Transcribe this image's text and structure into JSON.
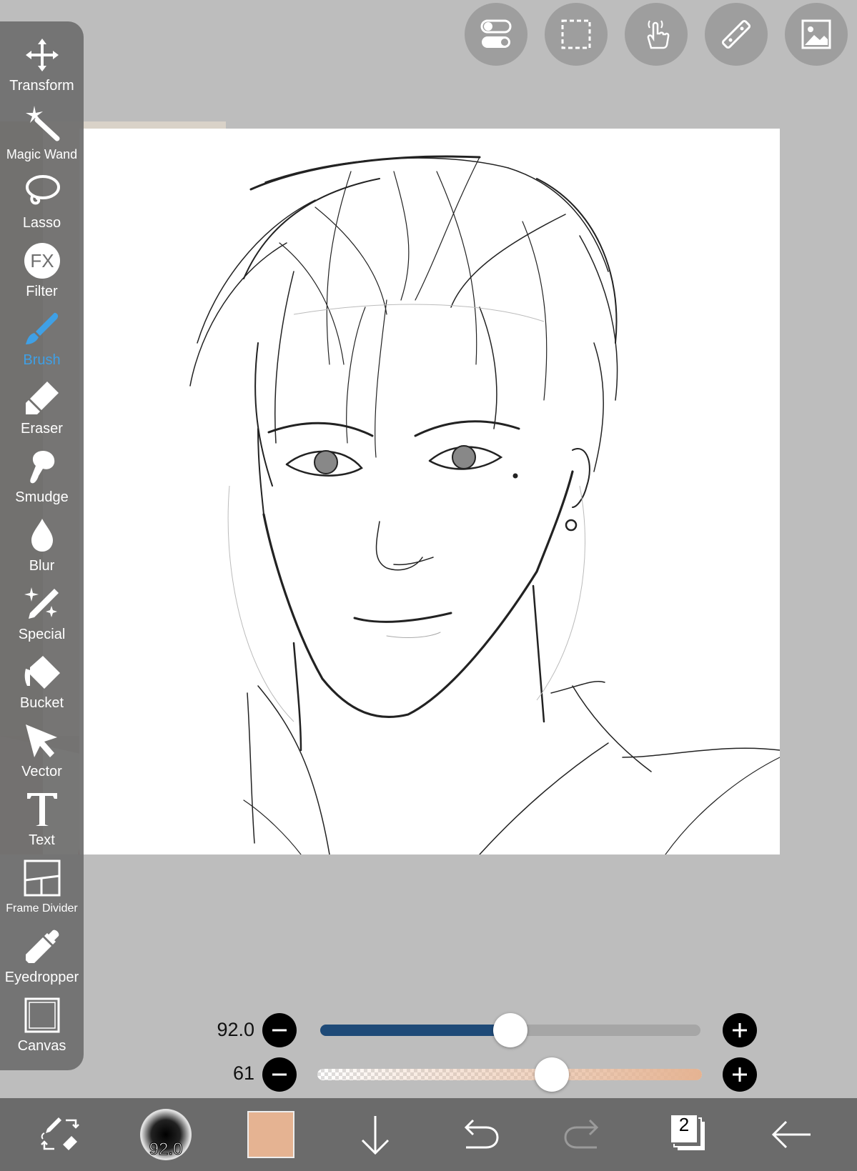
{
  "top_toolbar": {
    "buttons": [
      {
        "icon": "toggle-icon"
      },
      {
        "icon": "selection-icon"
      },
      {
        "icon": "touch-icon"
      },
      {
        "icon": "ruler-icon"
      },
      {
        "icon": "reference-image-icon"
      }
    ]
  },
  "sidebar": {
    "tools": [
      {
        "label": "Transform",
        "icon": "transform-icon"
      },
      {
        "label": "Magic Wand",
        "icon": "magic-wand-icon"
      },
      {
        "label": "Lasso",
        "icon": "lasso-icon"
      },
      {
        "label": "Filter",
        "icon": "fx-icon"
      },
      {
        "label": "Brush",
        "icon": "brush-icon",
        "active": true
      },
      {
        "label": "Eraser",
        "icon": "eraser-icon"
      },
      {
        "label": "Smudge",
        "icon": "smudge-icon"
      },
      {
        "label": "Blur",
        "icon": "blur-icon"
      },
      {
        "label": "Special",
        "icon": "special-icon"
      },
      {
        "label": "Bucket",
        "icon": "bucket-icon"
      },
      {
        "label": "Vector",
        "icon": "vector-icon"
      },
      {
        "label": "Text",
        "icon": "text-icon"
      },
      {
        "label": "Frame Divider",
        "icon": "frame-divider-icon"
      },
      {
        "label": "Eyedropper",
        "icon": "eyedropper-icon"
      },
      {
        "label": "Canvas",
        "icon": "canvas-icon"
      }
    ]
  },
  "sliders": {
    "size": {
      "value": "92.0",
      "fill": 0.5,
      "color": "#1e4a78"
    },
    "opacity": {
      "value": "61",
      "fill": 0.61,
      "color": "#e5b392"
    }
  },
  "bottom_bar": {
    "brush_size": "92.0",
    "color": "#e5b392",
    "layer_count": "2"
  }
}
